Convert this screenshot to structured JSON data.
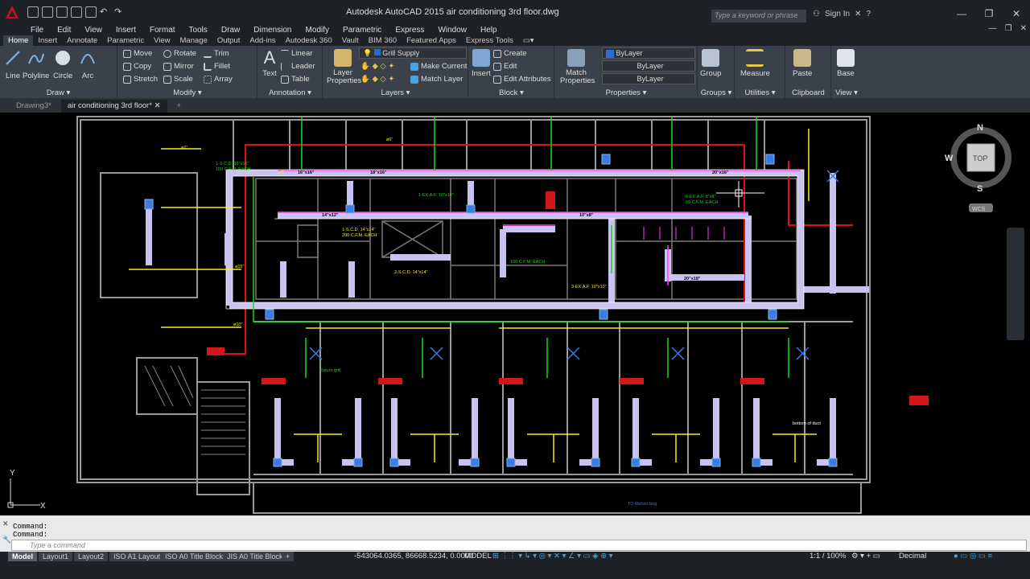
{
  "app": {
    "title": "Autodesk AutoCAD 2015   air conditioning 3rd floor.dwg",
    "search_placeholder": "Type a keyword or phrase",
    "signin_label": "Sign In"
  },
  "menu": [
    "File",
    "Edit",
    "View",
    "Insert",
    "Format",
    "Tools",
    "Draw",
    "Dimension",
    "Modify",
    "Parametric",
    "Express",
    "Window",
    "Help"
  ],
  "ribbon_tabs": [
    "Home",
    "Insert",
    "Annotate",
    "Parametric",
    "View",
    "Manage",
    "Output",
    "Add-ins",
    "Autodesk 360",
    "Vault",
    "BIM 360",
    "Featured Apps",
    "Express Tools"
  ],
  "ribbon": {
    "draw": {
      "title": "Draw",
      "line": "Line",
      "polyline": "Polyline",
      "circle": "Circle",
      "arc": "Arc"
    },
    "modify": {
      "title": "Modify",
      "move": "Move",
      "rotate": "Rotate",
      "trim": "Trim",
      "copy": "Copy",
      "mirror": "Mirror",
      "fillet": "Fillet",
      "stretch": "Stretch",
      "scale": "Scale",
      "array": "Array"
    },
    "annotation": {
      "title": "Annotation",
      "text": "Text",
      "linear": "Linear",
      "leader": "Leader",
      "table": "Table"
    },
    "layers": {
      "title": "Layers",
      "layer_properties": "Layer Properties",
      "current_layer": "Grill Supply",
      "make_current": "Make Current",
      "match_layer": "Match Layer"
    },
    "block": {
      "title": "Block",
      "insert": "Insert",
      "create": "Create",
      "edit": "Edit",
      "edit_attributes": "Edit Attributes"
    },
    "properties": {
      "title": "Properties",
      "match_properties": "Match Properties",
      "color": "ByLayer",
      "linetype": "ByLayer",
      "lineweight": "ByLayer"
    },
    "groups": {
      "title": "Groups",
      "group": "Group"
    },
    "utilities": {
      "title": "Utilities",
      "measure": "Measure"
    },
    "clipboard": {
      "title": "Clipboard",
      "paste": "Paste"
    },
    "view": {
      "title": "View",
      "base": "Base"
    }
  },
  "doc_tabs": [
    "Drawing3*",
    "air conditioning 3rd floor*"
  ],
  "viewcube": {
    "n": "N",
    "s": "S",
    "w": "W",
    "top": "TOP",
    "wcs": "WCS"
  },
  "ucs": {
    "x": "X",
    "y": "Y"
  },
  "command": {
    "line1": "Command:",
    "line2": "Command:",
    "placeholder": "Type a command"
  },
  "layout_tabs": [
    "Model",
    "Layout1",
    "Layout2",
    "ISO A1 Layout",
    "ISO A0 Title Block",
    "JIS A0 Title Block"
  ],
  "status": {
    "coords": "-543064.0365, 86668.5234, 0.0000",
    "model": "MODEL",
    "scale": "1:1 / 100%",
    "units": "Decimal"
  },
  "drawing_labels": [
    "1-S.C.D. 16\"x16\"",
    "150 C.F.M. EACH",
    "1-S.C.D. 14\"x14\"",
    "200 C.F.M. EACH",
    "2-S.C.D. 14\"x14\"",
    "1-EX.A.F. 10\"x10\"",
    "100 C.F.M. EACH",
    "3-EX.A.F. 10\"x10\"",
    "6-EX.A.F. 8\"x8\"",
    "50 C.F.M. EACH",
    "18\"x16\"",
    "16\"x16\"",
    "14\"x12\"",
    "20\"x16\"",
    "20\"x18\"",
    "10\"x8\"",
    "ø4\"",
    "ø1\"",
    "ø6\"",
    "ø10\"",
    "ø15\"",
    "bottom of duct",
    "Return grill",
    "TO Return bog"
  ]
}
